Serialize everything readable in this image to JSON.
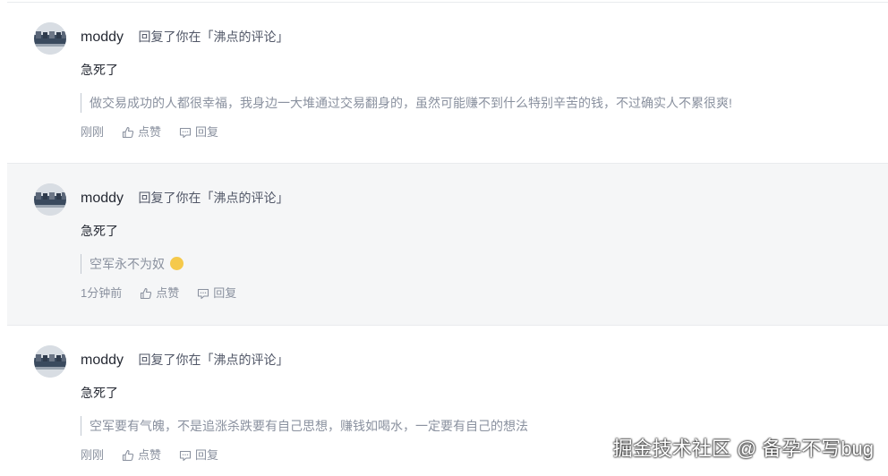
{
  "notifications": [
    {
      "username": "moddy",
      "action": "回复了你在「沸点的评论」",
      "reply": "急死了",
      "quoted": "做交易成功的人都很幸福，我身边一大堆通过交易翻身的，虽然可能赚不到什么特别辛苦的钱，不过确实人不累很爽!",
      "time": "刚刚",
      "like_label": "点赞",
      "reply_label": "回复"
    },
    {
      "username": "moddy",
      "action": "回复了你在「沸点的评论」",
      "reply": "急死了",
      "quoted": "空军永不为奴",
      "quoted_emoji": "clap-emoji-icon",
      "time": "1分钟前",
      "like_label": "点赞",
      "reply_label": "回复"
    },
    {
      "username": "moddy",
      "action": "回复了你在「沸点的评论」",
      "reply": "急死了",
      "quoted": "空军要有气魄，不是追涨杀跌要有自己思想，赚钱如喝水，一定要有自己的想法",
      "time": "刚刚",
      "like_label": "点赞",
      "reply_label": "回复"
    }
  ],
  "watermark": "掘金技术社区 @ 备孕不写bug",
  "colors": {
    "highlight_background": "#f5f6f7",
    "quote_text": "#8a919f",
    "primary_text": "#252933"
  }
}
